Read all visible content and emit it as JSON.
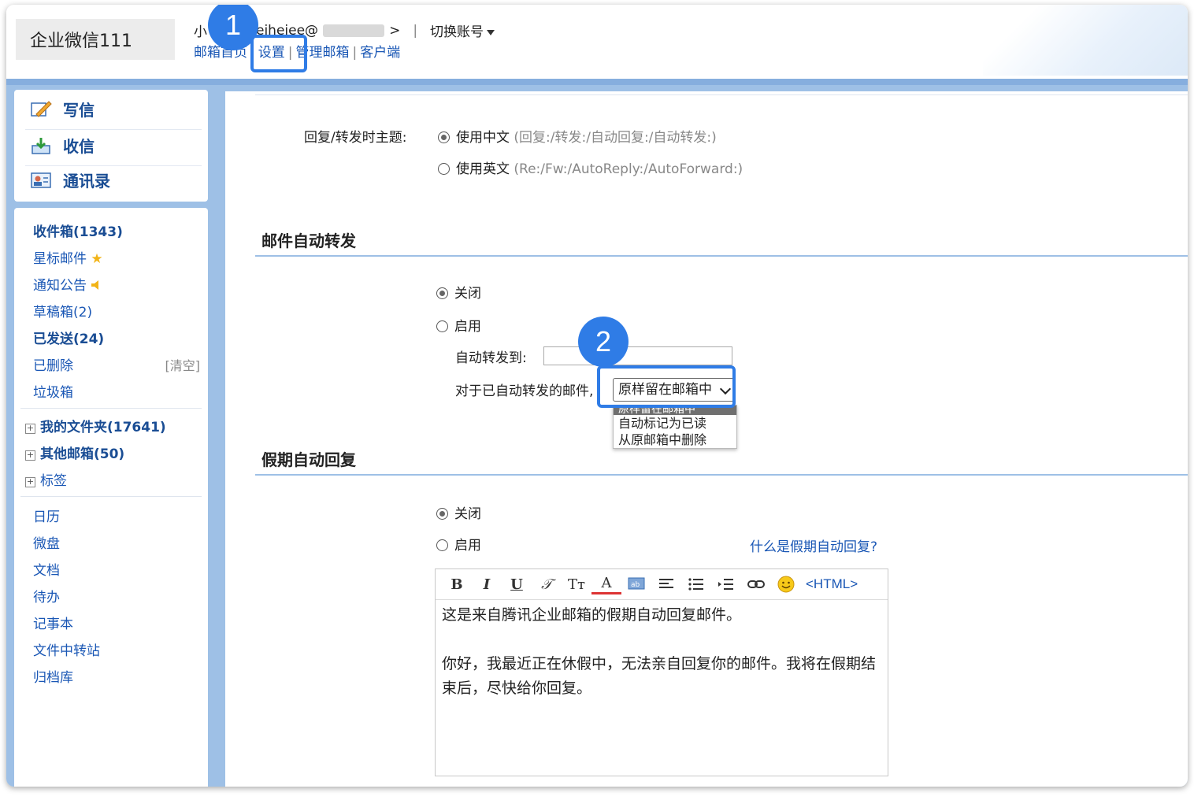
{
  "header": {
    "logo_text": "企业微信111",
    "user_prefix": "小",
    "user_email_partial": "eihejee@",
    "user_email_tail": ">",
    "switch_account": "切换账号",
    "links": [
      "邮箱首页",
      "设置",
      "管理邮箱",
      "客户端"
    ],
    "link_sep": "|"
  },
  "badges": [
    "1",
    "2"
  ],
  "quick": {
    "compose": "写信",
    "inbox": "收信",
    "contacts": "通讯录"
  },
  "folders": {
    "inbox": "收件箱(1343)",
    "starred": "星标邮件",
    "notices": "通知公告",
    "drafts": "草稿箱(2)",
    "sent": "已发送(24)",
    "deleted": "已删除",
    "clear": "[清空]",
    "spam": "垃圾箱",
    "my_folders": "我的文件夹(17641)",
    "other_mailboxes": "其他邮箱(50)",
    "tags": "标签",
    "apps": [
      "日历",
      "微盘",
      "文档",
      "待办",
      "记事本",
      "文件中转站",
      "归档库"
    ]
  },
  "reply_subject": {
    "label": "回复/转发时主题:",
    "opt_cn": "使用中文",
    "opt_cn_hint": "(回复:/转发:/自动回复:/自动转发:)",
    "opt_en": "使用英文",
    "opt_en_hint": "(Re:/Fw:/AutoReply:/AutoForward:)"
  },
  "auto_forward": {
    "title": "邮件自动转发",
    "off": "关闭",
    "on": "启用",
    "forward_to_label": "自动转发到:",
    "forward_to_value": "",
    "handled_label": "对于已自动转发的邮件,",
    "handled_selected": "原样留在邮箱中",
    "handled_options": [
      "原样留在邮箱中",
      "自动标记为已读",
      "从原邮箱中删除"
    ]
  },
  "vacation": {
    "title": "假期自动回复",
    "off": "关闭",
    "on": "启用",
    "help_link": "什么是假期自动回复?",
    "html_button": "<HTML>",
    "body_line1": "这是来自腾讯企业邮箱的假期自动回复邮件。",
    "body_line2": "你好，我最近正在休假中，无法亲自回复你的邮件。我将在假期结束后，尽快给你回复。"
  },
  "colors": {
    "accent": "#2f7ce6",
    "link": "#1a57b5",
    "panel": "#9ec0e6"
  }
}
